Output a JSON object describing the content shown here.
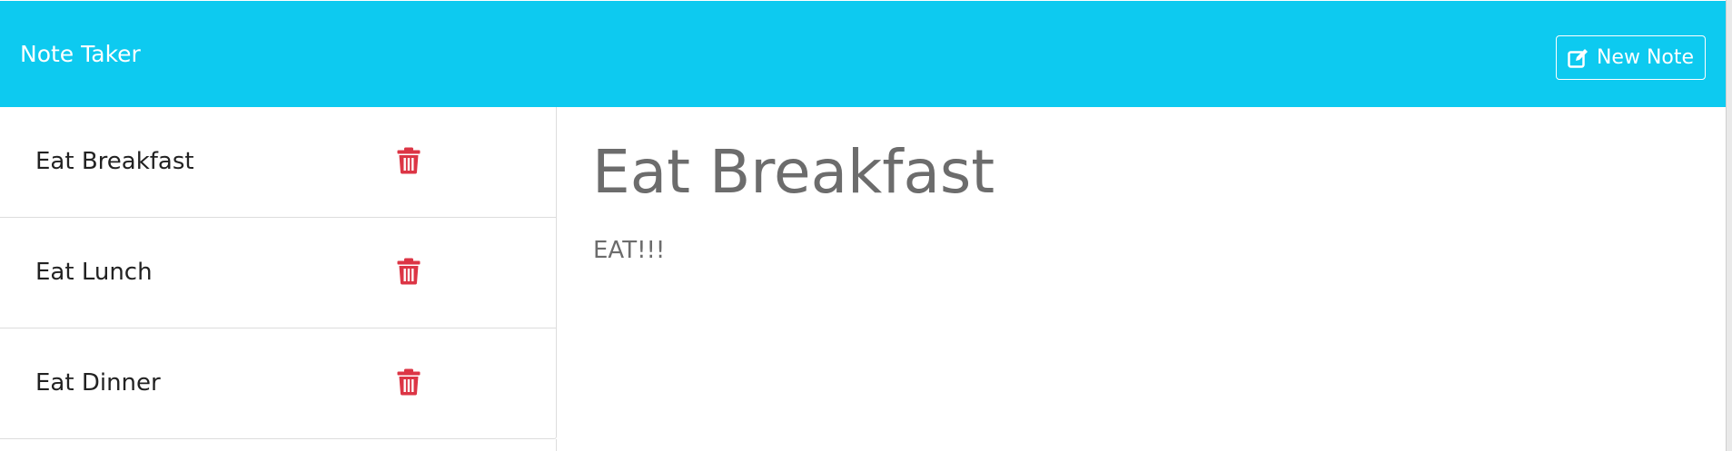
{
  "navbar": {
    "brand": "Note Taker",
    "new_note_label": "New Note",
    "background_color": "#0dcaf0"
  },
  "notes": [
    {
      "title": "Eat Breakfast",
      "icon": "trash-icon"
    },
    {
      "title": "Eat Lunch",
      "icon": "trash-icon"
    },
    {
      "title": "Eat Dinner",
      "icon": "trash-icon"
    }
  ],
  "editor": {
    "title": "Eat Breakfast",
    "text": "EAT!!!"
  },
  "colors": {
    "accent": "#0dcaf0",
    "delete": "#dc3545",
    "note_text": "#6c6c6c"
  }
}
